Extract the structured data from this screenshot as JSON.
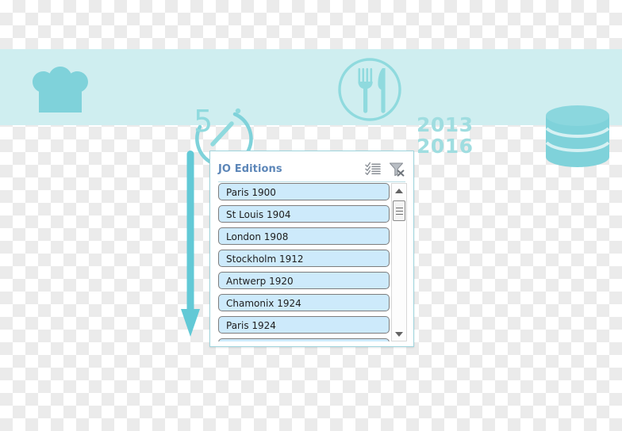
{
  "banner": {
    "icons": [
      {
        "name": "chef-hat-icon",
        "label": "chef hat"
      },
      {
        "name": "timer-icon",
        "label": "timer",
        "value": "5"
      },
      {
        "name": "plate-cutlery-icon",
        "label": "plate with fork and knife"
      },
      {
        "name": "database-icon",
        "label": "database"
      }
    ],
    "years": [
      "2013",
      "2016"
    ],
    "background_color": "#cfeef0",
    "icon_color": "#7fd2da",
    "years_color": "#9fdde0"
  },
  "arrow": {
    "name": "down-arrow",
    "color": "#62c9d6",
    "direction": "down"
  },
  "panel": {
    "title": "JO Editions",
    "title_color": "#5c86b8",
    "border_color": "#9ed4dd",
    "actions": [
      {
        "name": "check-list-icon",
        "label": "Select all"
      },
      {
        "name": "clear-filter-icon",
        "label": "Clear filter"
      }
    ],
    "items": [
      "Paris 1900",
      "St Louis 1904",
      "London 1908",
      "Stockholm 1912",
      "Antwerp 1920",
      "Chamonix 1924",
      "Paris 1924",
      ""
    ],
    "item_fill_color": "#cdeafb",
    "item_border_color": "#7d7d7d",
    "scrollbar": {
      "up_label": "Scroll up",
      "down_label": "Scroll down",
      "thumb_label": "Scroll thumb"
    }
  }
}
